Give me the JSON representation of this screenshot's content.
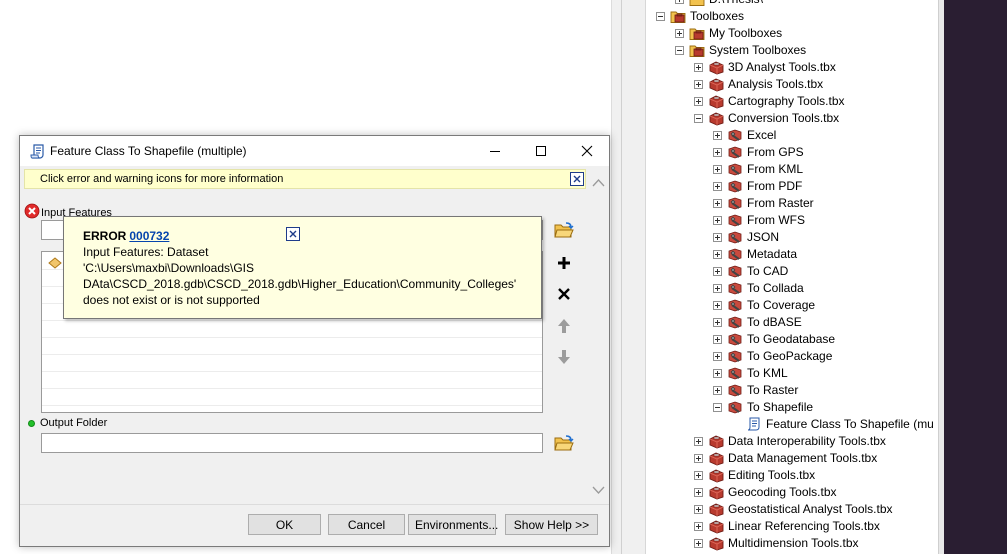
{
  "dialog": {
    "title": "Feature Class To Shapefile (multiple)",
    "info_message": "Click error and warning icons for more information",
    "input_features_label": "Input Features",
    "output_folder_label": "Output Folder",
    "buttons": {
      "ok": "OK",
      "cancel": "Cancel",
      "environments": "Environments...",
      "show_help": "Show Help >>"
    },
    "error": {
      "prefix": "ERROR",
      "code": "000732",
      "lines": [
        "Input Features: Dataset",
        "'C:\\Users\\maxbi\\Downloads\\GIS",
        "DAta\\CSCD_2018.gdb\\CSCD_2018.gdb\\Higher_Education\\Community_Colleges'",
        "does not exist or is not supported"
      ]
    }
  },
  "catalog_tree": {
    "items": [
      {
        "label": "D:\\Thesis\\",
        "level": 1,
        "expander": "plus",
        "icon": "folder-icon"
      },
      {
        "label": "Toolboxes",
        "level": 0,
        "expander": "minus",
        "icon": "toolboxes-icon"
      },
      {
        "label": "My Toolboxes",
        "level": 1,
        "expander": "plus",
        "icon": "toolbox-folder-icon"
      },
      {
        "label": "System Toolboxes",
        "level": 1,
        "expander": "minus",
        "icon": "toolbox-folder-icon"
      },
      {
        "label": "3D Analyst Tools.tbx",
        "level": 2,
        "expander": "plus",
        "icon": "toolbox-icon"
      },
      {
        "label": "Analysis Tools.tbx",
        "level": 2,
        "expander": "plus",
        "icon": "toolbox-icon"
      },
      {
        "label": "Cartography Tools.tbx",
        "level": 2,
        "expander": "plus",
        "icon": "toolbox-icon"
      },
      {
        "label": "Conversion Tools.tbx",
        "level": 2,
        "expander": "minus",
        "icon": "toolbox-icon"
      },
      {
        "label": "Excel",
        "level": 3,
        "expander": "plus",
        "icon": "toolset-icon"
      },
      {
        "label": "From GPS",
        "level": 3,
        "expander": "plus",
        "icon": "toolset-icon"
      },
      {
        "label": "From KML",
        "level": 3,
        "expander": "plus",
        "icon": "toolset-icon"
      },
      {
        "label": "From PDF",
        "level": 3,
        "expander": "plus",
        "icon": "toolset-icon"
      },
      {
        "label": "From Raster",
        "level": 3,
        "expander": "plus",
        "icon": "toolset-icon"
      },
      {
        "label": "From WFS",
        "level": 3,
        "expander": "plus",
        "icon": "toolset-icon"
      },
      {
        "label": "JSON",
        "level": 3,
        "expander": "plus",
        "icon": "toolset-icon"
      },
      {
        "label": "Metadata",
        "level": 3,
        "expander": "plus",
        "icon": "toolset-icon"
      },
      {
        "label": "To CAD",
        "level": 3,
        "expander": "plus",
        "icon": "toolset-icon"
      },
      {
        "label": "To Collada",
        "level": 3,
        "expander": "plus",
        "icon": "toolset-icon"
      },
      {
        "label": "To Coverage",
        "level": 3,
        "expander": "plus",
        "icon": "toolset-icon"
      },
      {
        "label": "To dBASE",
        "level": 3,
        "expander": "plus",
        "icon": "toolset-icon"
      },
      {
        "label": "To Geodatabase",
        "level": 3,
        "expander": "plus",
        "icon": "toolset-icon"
      },
      {
        "label": "To GeoPackage",
        "level": 3,
        "expander": "plus",
        "icon": "toolset-icon"
      },
      {
        "label": "To KML",
        "level": 3,
        "expander": "plus",
        "icon": "toolset-icon"
      },
      {
        "label": "To Raster",
        "level": 3,
        "expander": "plus",
        "icon": "toolset-icon"
      },
      {
        "label": "To Shapefile",
        "level": 3,
        "expander": "minus",
        "icon": "toolset-icon"
      },
      {
        "label": "Feature Class To Shapefile (mu",
        "level": 4,
        "expander": "none",
        "icon": "script-tool-icon"
      },
      {
        "label": "Data Interoperability Tools.tbx",
        "level": 2,
        "expander": "plus",
        "icon": "toolbox-icon"
      },
      {
        "label": "Data Management Tools.tbx",
        "level": 2,
        "expander": "plus",
        "icon": "toolbox-icon"
      },
      {
        "label": "Editing Tools.tbx",
        "level": 2,
        "expander": "plus",
        "icon": "toolbox-icon"
      },
      {
        "label": "Geocoding Tools.tbx",
        "level": 2,
        "expander": "plus",
        "icon": "toolbox-icon"
      },
      {
        "label": "Geostatistical Analyst Tools.tbx",
        "level": 2,
        "expander": "plus",
        "icon": "toolbox-icon"
      },
      {
        "label": "Linear Referencing Tools.tbx",
        "level": 2,
        "expander": "plus",
        "icon": "toolbox-icon"
      },
      {
        "label": "Multidimension Tools.tbx",
        "level": 2,
        "expander": "plus",
        "icon": "toolbox-icon"
      }
    ]
  },
  "colors": {
    "info_bar": "#ffffcc",
    "tooltip": "#ffffe1",
    "error_link": "#0645ad",
    "toolbox_red": "#b83a2e",
    "valid_green": "#22c02a"
  }
}
